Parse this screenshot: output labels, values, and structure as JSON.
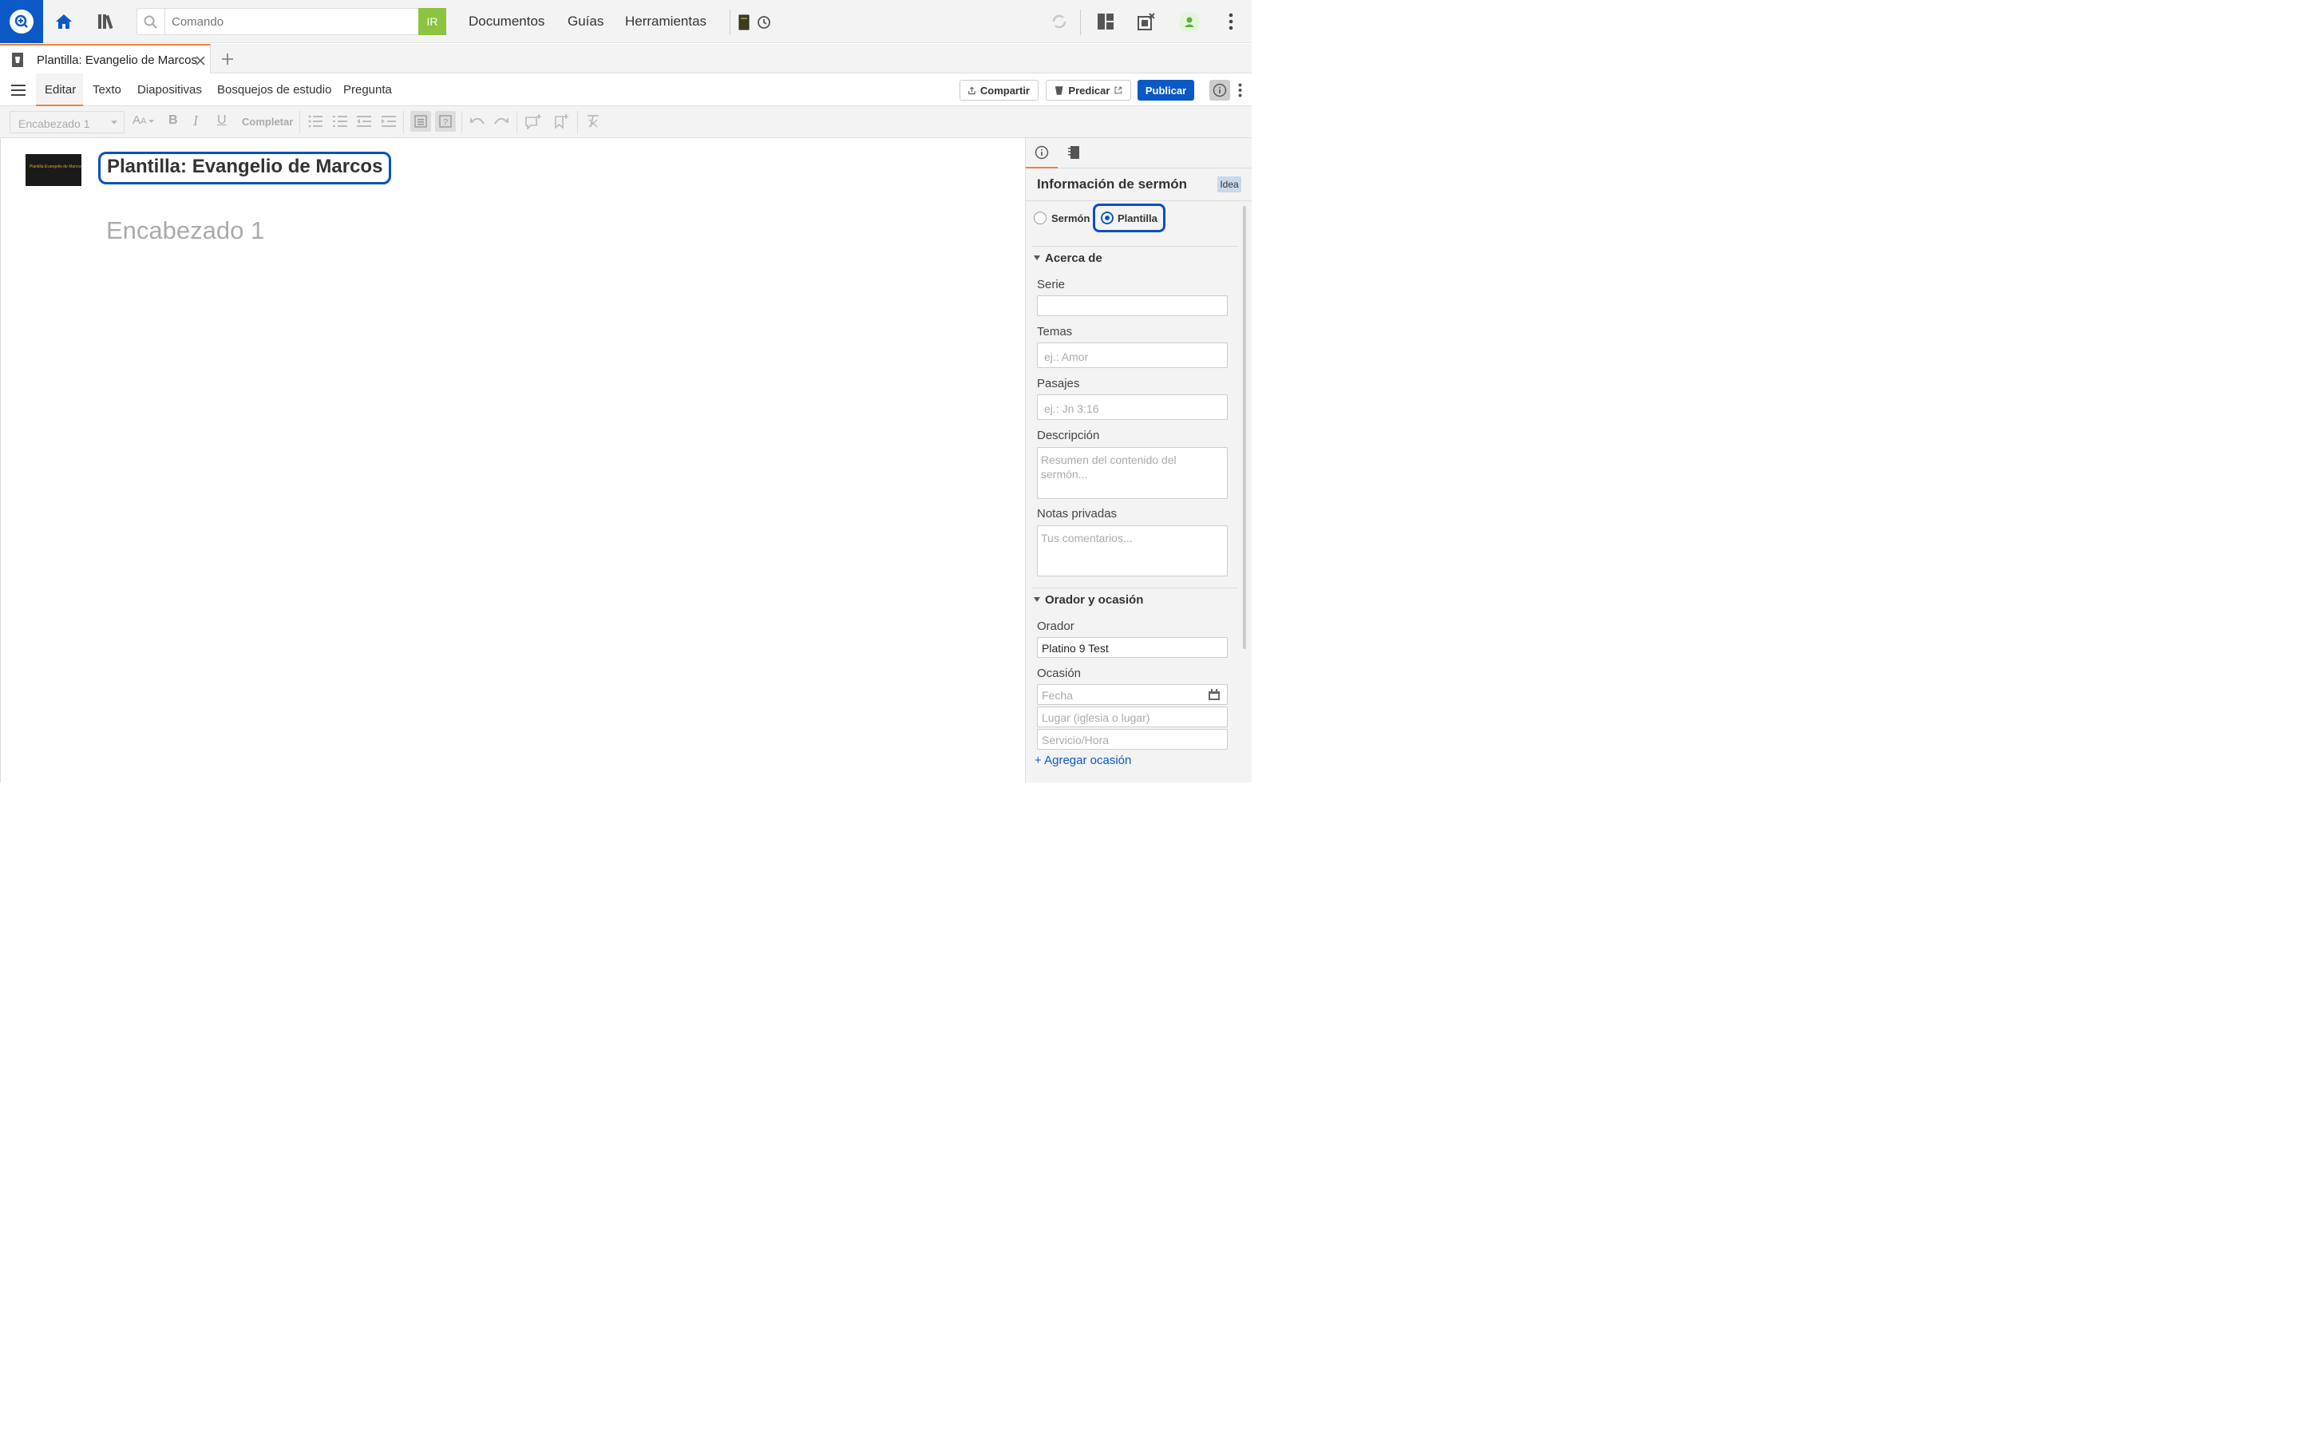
{
  "search": {
    "placeholder": "Comando",
    "go_label": "IR"
  },
  "nav": {
    "documentos": "Documentos",
    "guias": "Guías",
    "herramientas": "Herramientas"
  },
  "tab": {
    "label": "Plantilla: Evangelio de Marcos"
  },
  "menu": {
    "editar": "Editar",
    "texto": "Texto",
    "diapositivas": "Diapositivas",
    "bosquejos": "Bosquejos de estudio",
    "pregunta": "Pregunta"
  },
  "actions": {
    "compartir": "Compartir",
    "predicar": "Predicar",
    "publicar": "Publicar"
  },
  "toolbar": {
    "style_value": "Encabezado 1",
    "completar": "Completar"
  },
  "editor": {
    "title": "Plantilla: Evangelio de Marcos",
    "heading_placeholder": "Encabezado 1",
    "thumbnail_caption": "Plantilla Evangelio de Marcos"
  },
  "panel": {
    "title": "Información de sermón",
    "badge": "Idea",
    "radio_sermon": "Sermón",
    "radio_plantilla": "Plantilla",
    "section_about": "Acerca de",
    "serie_label": "Serie",
    "serie_value": "",
    "temas_label": "Temas",
    "temas_placeholder": "ej.: Amor",
    "pasajes_label": "Pasajes",
    "pasajes_placeholder": "ej.: Jn 3:16",
    "descripcion_label": "Descripción",
    "descripcion_placeholder": "Resumen del contenido del sermón...",
    "notas_label": "Notas privadas",
    "notas_placeholder": "Tus comentarios...",
    "section_orador": "Orador y ocasión",
    "orador_label": "Orador",
    "orador_value": "Platino 9 Test",
    "ocasion_label": "Ocasión",
    "fecha_placeholder": "Fecha",
    "lugar_placeholder": "Lugar (iglesia o lugar)",
    "servicio_placeholder": "Servicio/Hora",
    "add_occasion": "+ Agregar ocasión"
  },
  "colors": {
    "accent": "#0b59c6",
    "tab_accent": "#f07f3c",
    "go_green": "#8cc43f"
  }
}
